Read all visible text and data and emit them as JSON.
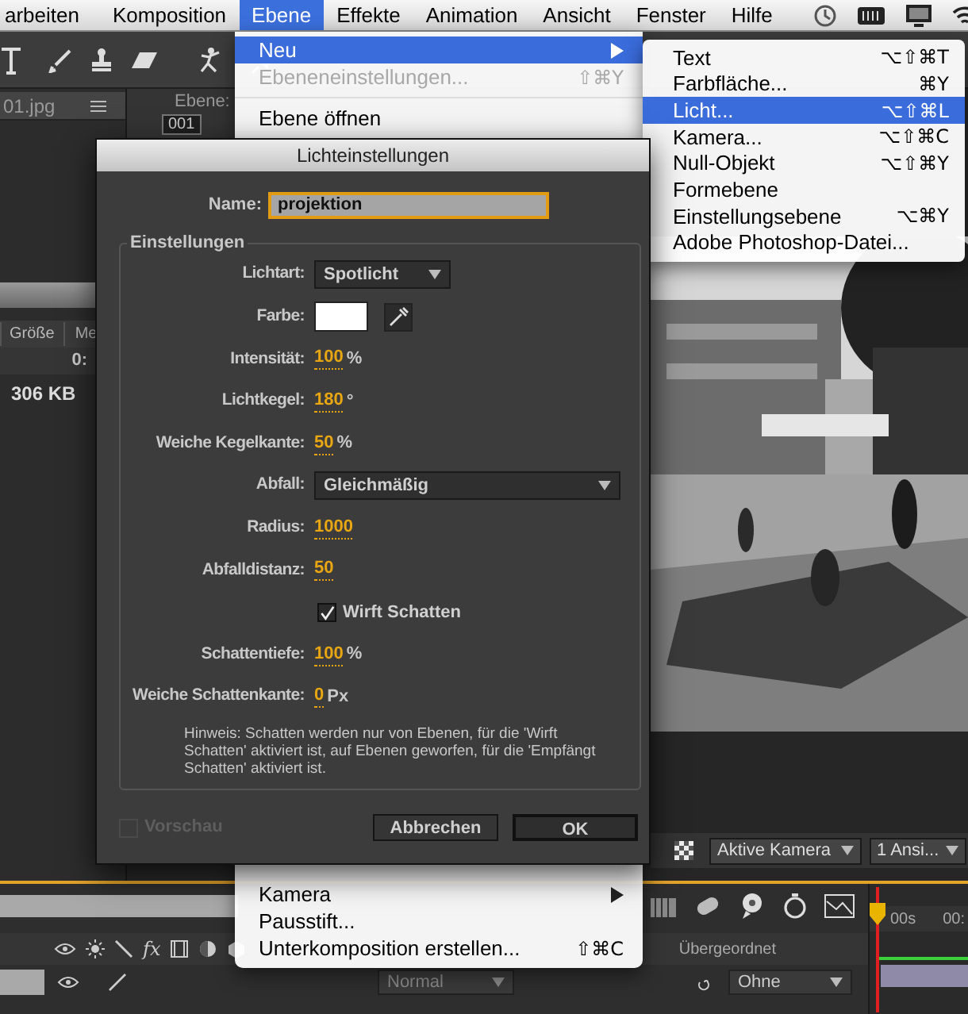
{
  "menu_bar": {
    "items": [
      {
        "label": "arbeiten",
        "selected": false
      },
      {
        "label": "Komposition",
        "selected": false
      },
      {
        "label": "Ebene",
        "selected": true
      },
      {
        "label": "Effekte",
        "selected": false
      },
      {
        "label": "Animation",
        "selected": false
      },
      {
        "label": "Ansicht",
        "selected": false
      },
      {
        "label": "Fenster",
        "selected": false
      },
      {
        "label": "Hilfe",
        "selected": false
      }
    ]
  },
  "project_panel": {
    "tab": "01.jpg",
    "columns": [
      "Größe",
      "Me"
    ],
    "time": "0:",
    "size": "306 KB"
  },
  "layer_panel": {
    "title": "Ebene:",
    "frame": "001"
  },
  "viewer": {
    "camera": "Aktive Kamera",
    "views": "1 Ansi..."
  },
  "timeline": {
    "fx": "fx",
    "parent_header": "Übergeordnet",
    "mode": "Normal",
    "parent": "Ohne",
    "ruler": [
      "00s",
      "00:"
    ]
  },
  "layer_menu": {
    "top_items": [
      {
        "kind": "item",
        "label": "Neu",
        "submenu": true,
        "selected": true,
        "disabled": false
      },
      {
        "kind": "item",
        "label": "Ebeneneinstellungen...",
        "shortcut": "⇧⌘Y",
        "submenu": false,
        "selected": false,
        "disabled": true
      },
      {
        "kind": "separator"
      },
      {
        "kind": "item",
        "label": "Ebene öffnen",
        "submenu": false,
        "selected": false,
        "disabled": false
      }
    ],
    "bottom_items": [
      {
        "kind": "item",
        "label": "Kamera",
        "submenu": true,
        "selected": false,
        "disabled": false
      },
      {
        "kind": "item",
        "label": "Pausstift...",
        "submenu": false,
        "selected": false,
        "disabled": false
      },
      {
        "kind": "item",
        "label": "Unterkomposition erstellen...",
        "shortcut": "⇧⌘C",
        "submenu": false,
        "selected": false,
        "disabled": false
      }
    ]
  },
  "new_submenu": {
    "items": [
      {
        "label": "Text",
        "shortcut": "⌥⇧⌘T",
        "selected": false
      },
      {
        "label": "Farbfläche...",
        "shortcut": "⌘Y",
        "selected": false
      },
      {
        "label": "Licht...",
        "shortcut": "⌥⇧⌘L",
        "selected": true
      },
      {
        "label": "Kamera...",
        "shortcut": "⌥⇧⌘C",
        "selected": false
      },
      {
        "label": "Null-Objekt",
        "shortcut": "⌥⇧⌘Y",
        "selected": false
      },
      {
        "label": "Formebene",
        "selected": false
      },
      {
        "label": "Einstellungsebene",
        "shortcut": "⌥⌘Y",
        "selected": false
      },
      {
        "label": "Adobe Photoshop-Datei...",
        "selected": false
      }
    ]
  },
  "dialog": {
    "title": "Lichteinstellungen",
    "name_label": "Name:",
    "name_value": "projektion",
    "group_title": "Einstellungen",
    "rows": [
      {
        "kind": "dropdown",
        "label": "Lichtart:",
        "value": "Spotlicht"
      },
      {
        "kind": "color",
        "label": "Farbe:",
        "color": "#ffffff"
      },
      {
        "kind": "number",
        "label": "Intensität:",
        "value": "100",
        "unit": "%"
      },
      {
        "kind": "number",
        "label": "Lichtkegel:",
        "value": "180",
        "unit": "°"
      },
      {
        "kind": "number",
        "label": "Weiche Kegelkante:",
        "value": "50",
        "unit": "%"
      },
      {
        "kind": "widedropdown",
        "label": "Abfall:",
        "value": "Gleichmäßig"
      },
      {
        "kind": "number",
        "label": "Radius:",
        "value": "1000"
      },
      {
        "kind": "number",
        "label": "Abfalldistanz:",
        "value": "50"
      },
      {
        "kind": "checkbox",
        "label": "Wirft Schatten",
        "checked": true
      },
      {
        "kind": "number",
        "label": "Schattentiefe:",
        "value": "100",
        "unit": "%"
      },
      {
        "kind": "number",
        "label": "Weiche Schattenkante:",
        "value": "0",
        "unit": "Px"
      }
    ],
    "note": "Hinweis: Schatten werden nur von Ebenen, für die 'Wirft Schatten' aktiviert ist, auf Ebenen geworfen, für die 'Empfängt Schatten' aktiviert ist.",
    "preview": {
      "label": "Vorschau",
      "checked": false,
      "disabled": true
    },
    "buttons": [
      {
        "label": "Abbrechen",
        "default": false
      },
      {
        "label": "OK",
        "default": true
      }
    ]
  }
}
